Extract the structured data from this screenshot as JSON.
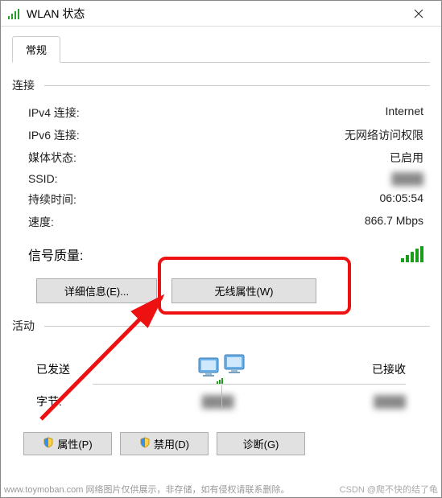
{
  "window": {
    "title": "WLAN 状态"
  },
  "tabs": {
    "general": "常规"
  },
  "sections": {
    "connection": "连接",
    "activity": "活动"
  },
  "connection": {
    "ipv4_label": "IPv4 连接:",
    "ipv4_value": "Internet",
    "ipv6_label": "IPv6 连接:",
    "ipv6_value": "无网络访问权限",
    "media_label": "媒体状态:",
    "media_value": "已启用",
    "ssid_label": "SSID:",
    "ssid_value": "████",
    "duration_label": "持续时间:",
    "duration_value": "06:05:54",
    "speed_label": "速度:",
    "speed_value": "866.7 Mbps",
    "signal_label": "信号质量:"
  },
  "buttons": {
    "details": "详细信息(E)...",
    "wireless_props": "无线属性(W)",
    "properties": "属性(P)",
    "disable": "禁用(D)",
    "diagnose": "诊断(G)"
  },
  "activity": {
    "sent_label": "已发送",
    "received_label": "已接收",
    "bytes_label": "字节:",
    "sent_value": "████",
    "received_value": "████"
  },
  "footer": {
    "left": "www.toymoban.com  网络图片仅供展示，非存储，如有侵权请联系删除。",
    "right": "CSDN @爬不快的结了龟"
  }
}
